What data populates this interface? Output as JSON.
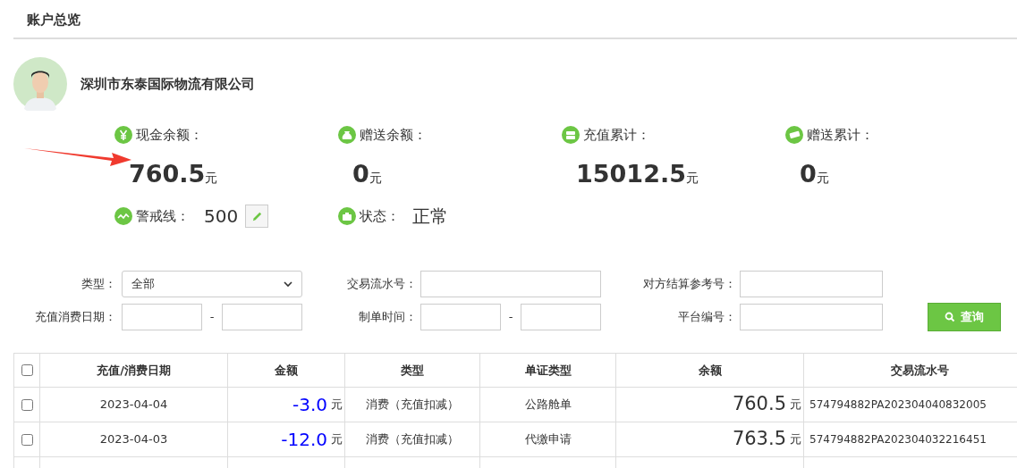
{
  "page_title": "账户总览",
  "company": {
    "name": "深圳市东泰国际物流有限公司"
  },
  "stats": [
    {
      "kind": "cash",
      "label": "现金余额：",
      "value": "760.5",
      "unit": "元"
    },
    {
      "kind": "gift",
      "label": "赠送余额：",
      "value": "0",
      "unit": "元"
    },
    {
      "kind": "recharge",
      "label": "充值累计：",
      "value": "15012.5",
      "unit": "元"
    },
    {
      "kind": "gift_total",
      "label": "赠送累计：",
      "value": "0",
      "unit": "元"
    }
  ],
  "alert_line": {
    "label": "警戒线：",
    "value": "500"
  },
  "status": {
    "label": "状态：",
    "value": "正常"
  },
  "filters": {
    "type_label": "类型：",
    "type_value": "全部",
    "serial_label": "交易流水号：",
    "ref_label": "对方结算参考号：",
    "date_label": "充值消费日期：",
    "date_sep": "-",
    "time_label": "制单时间：",
    "time_sep": "-",
    "platform_label": "平台编号：",
    "search_button": "查询"
  },
  "table": {
    "select_all_checked": false,
    "columns": [
      "充值/消费日期",
      "金额",
      "类型",
      "单证类型",
      "余额",
      "交易流水号"
    ],
    "rows": [
      {
        "checked": false,
        "date": "2023-04-04",
        "amount": "-3.0",
        "amount_unit": "元",
        "type": "消费（充值扣减）",
        "doc_type": "公路舱单",
        "balance": "760.5",
        "balance_unit": "元",
        "serial": "574794882PA202304040832005"
      },
      {
        "checked": false,
        "date": "2023-04-03",
        "amount": "-12.0",
        "amount_unit": "元",
        "type": "消费（充值扣减）",
        "doc_type": "代缴申请",
        "balance": "763.5",
        "balance_unit": "元",
        "serial": "574794882PA202304032216451"
      }
    ]
  }
}
